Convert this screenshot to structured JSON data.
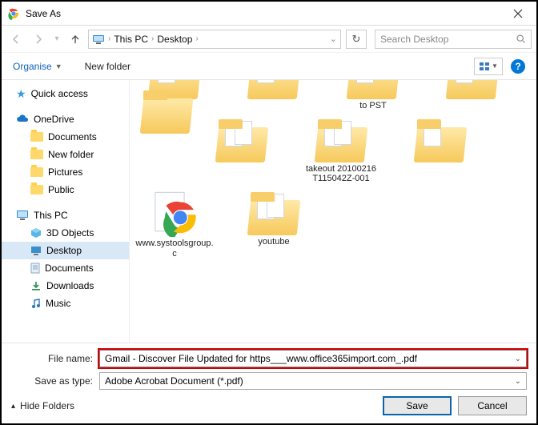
{
  "title": "Save As",
  "breadcrumb": {
    "root_icon": "pc",
    "seg1": "This PC",
    "seg2": "Desktop"
  },
  "search": {
    "placeholder": "Search Desktop"
  },
  "toolbar": {
    "organise": "Organise",
    "newfolder": "New folder"
  },
  "nav": {
    "quick": "Quick access",
    "onedrive": "OneDrive",
    "one": {
      "documents": "Documents",
      "newfolder": "New folder",
      "pictures": "Pictures",
      "public": "Public"
    },
    "thispc": "This PC",
    "pc": {
      "objects3d": "3D Objects",
      "desktop": "Desktop",
      "documents": "Documents",
      "downloads": "Downloads",
      "music": "Music"
    }
  },
  "grid": {
    "row1": {
      "a": "",
      "b": "",
      "c_line2": "to PST",
      "d": "",
      "e": ""
    },
    "row2": {
      "a": "",
      "b": "takeout  20100216\nT115042Z-001",
      "c": "",
      "d": "www.systoolsgroup.c"
    },
    "row3": {
      "a": "youtube"
    }
  },
  "fields": {
    "filename_label": "File name:",
    "filename_value": "Gmail - Discover File Updated for https___www.office365import.com_.pdf",
    "savetype_label": "Save as type:",
    "savetype_value": "Adobe Acrobat Document (*.pdf)"
  },
  "actions": {
    "hide": "Hide Folders",
    "save": "Save",
    "cancel": "Cancel"
  }
}
